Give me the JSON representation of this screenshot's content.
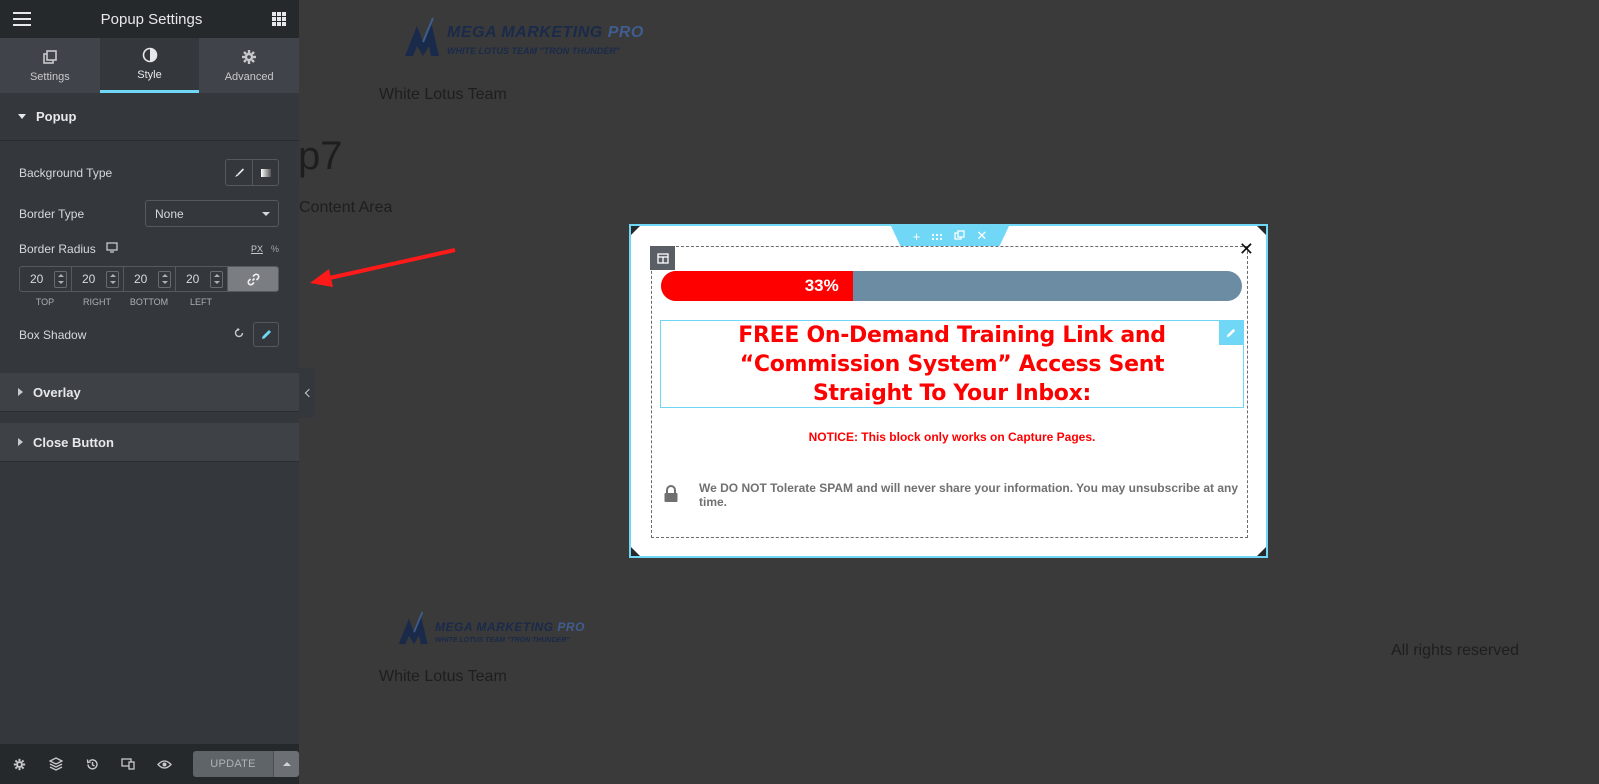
{
  "sidebar": {
    "title": "Popup Settings",
    "tabs": [
      {
        "label": "Settings",
        "icon": "copy-icon"
      },
      {
        "label": "Style",
        "icon": "half-circle-icon"
      },
      {
        "label": "Advanced",
        "icon": "gear-icon"
      }
    ],
    "sections": {
      "popup": "Popup",
      "overlay": "Overlay",
      "close_button": "Close Button"
    },
    "controls": {
      "background_type_label": "Background Type",
      "border_type_label": "Border Type",
      "border_type_value": "None",
      "border_radius_label": "Border Radius",
      "unit_px": "PX",
      "unit_percent": "%",
      "radius_top": "20",
      "radius_right": "20",
      "radius_bottom": "20",
      "radius_left": "20",
      "label_top": "TOP",
      "label_right": "RIGHT",
      "label_bottom": "BOTTOM",
      "label_left": "LEFT",
      "box_shadow_label": "Box Shadow"
    },
    "footer": {
      "update_label": "UPDATE"
    }
  },
  "page": {
    "logo_text_1": "MEGA MARKETING",
    "logo_text_pro": "PRO",
    "logo_subtext": "WHITE LOTUS TEAM \"TRON THUNDER\"",
    "team_name": "White Lotus Team",
    "heading_fragment": "p7",
    "content_fragment": "Content Area",
    "rights": "All rights reserved"
  },
  "popup": {
    "progress_label": "33%",
    "progress_value": 0.33,
    "headline": "FREE On-Demand Training Link and “Commission System” Access Sent Straight To Your Inbox:",
    "notice": "NOTICE: This block only works on Capture Pages.",
    "spam_text": "We DO NOT Tolerate SPAM and will never share your information. You may unsubscribe at any time."
  },
  "colors": {
    "accent": "#71d7f7",
    "progress_fill": "#ff0000",
    "progress_track": "#6b8ca3",
    "headline": "#ff0000"
  }
}
